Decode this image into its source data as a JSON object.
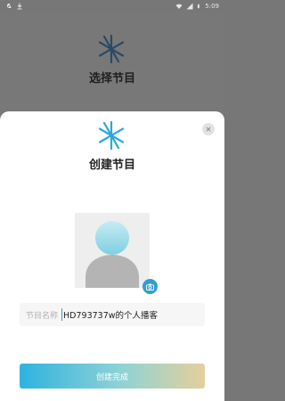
{
  "status_bar": {
    "time": "5:09",
    "left_icons": [
      "notification-muted-icon",
      "download-icon"
    ],
    "right_icons": [
      "wifi-icon",
      "signal-icon",
      "battery-icon"
    ]
  },
  "background_screen": {
    "title": "选择节目",
    "logo_icon": "star-burst-icon"
  },
  "sheet": {
    "title": "创建节目",
    "logo_icon": "star-burst-icon",
    "close_icon": "close-icon",
    "avatar_icon": "avatar-placeholder-icon",
    "camera_icon": "camera-icon",
    "name_field": {
      "label": "节目名称",
      "value": "HD793737w的个人播客"
    },
    "submit_label": "创建完成"
  },
  "colors": {
    "accent": "#2f9fce",
    "overlay": "#787878",
    "button_gradient": [
      "#2eb3df",
      "#8fd2d6",
      "#e5d09b"
    ]
  }
}
